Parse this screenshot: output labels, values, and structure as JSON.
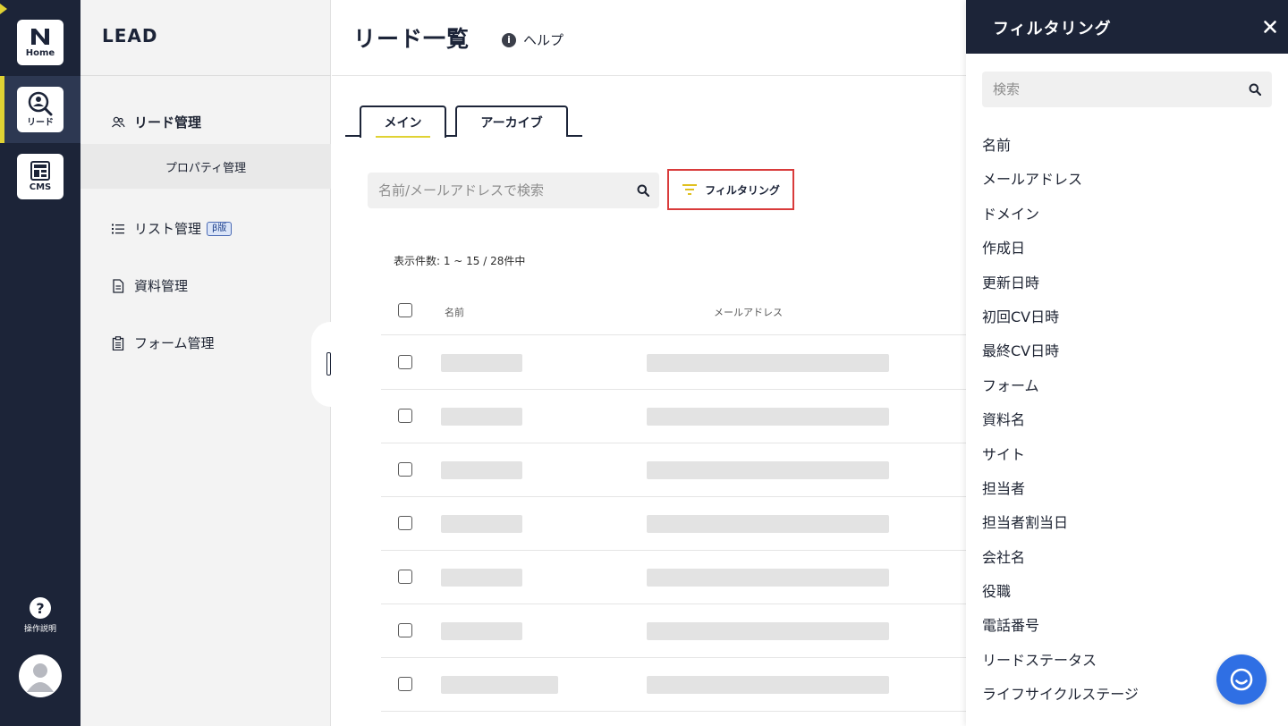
{
  "rail": {
    "items": [
      {
        "label": "Home",
        "icon": "home-logo-icon"
      },
      {
        "label": "リード",
        "icon": "lead-search-icon"
      },
      {
        "label": "CMS",
        "icon": "cms-icon"
      }
    ],
    "help_label": "操作説明",
    "help_glyph": "?",
    "accent": "#e0d233",
    "background": "#1c2438"
  },
  "sidebar": {
    "brand": "LEAD",
    "items": [
      {
        "label": "リード管理",
        "icon": "users-icon"
      },
      {
        "label": "プロパティ管理"
      },
      {
        "label": "リスト管理",
        "icon": "list-icon",
        "badge": "β版"
      },
      {
        "label": "資料管理",
        "icon": "document-icon"
      },
      {
        "label": "フォーム管理",
        "icon": "clipboard-icon"
      }
    ]
  },
  "header": {
    "title": "リード一覧",
    "help_label": "ヘルプ",
    "help_glyph": "i"
  },
  "tabs": [
    {
      "label": "メイン",
      "active": true
    },
    {
      "label": "アーカイブ",
      "active": false
    }
  ],
  "search": {
    "placeholder": "名前/メールアドレスで検索",
    "value": ""
  },
  "filter_button": {
    "label": "フィルタリング",
    "highlight_color": "#d93b3b"
  },
  "results": {
    "count_text": "表示件数: 1 ~ 15 / 28件中"
  },
  "table": {
    "columns": [
      "名前",
      "メールアドレス"
    ],
    "loading_rows": 7
  },
  "panel": {
    "title": "フィルタリング",
    "search_placeholder": "検索",
    "fields": [
      "名前",
      "メールアドレス",
      "ドメイン",
      "作成日",
      "更新日時",
      "初回CV日時",
      "最終CV日時",
      "フォーム",
      "資料名",
      "サイト",
      "担当者",
      "担当者割当日",
      "会社名",
      "役職",
      "電話番号",
      "リードステータス",
      "ライフサイクルステージ"
    ]
  },
  "chat": {
    "icon": "chat-icon",
    "color": "#2f6fe4"
  }
}
